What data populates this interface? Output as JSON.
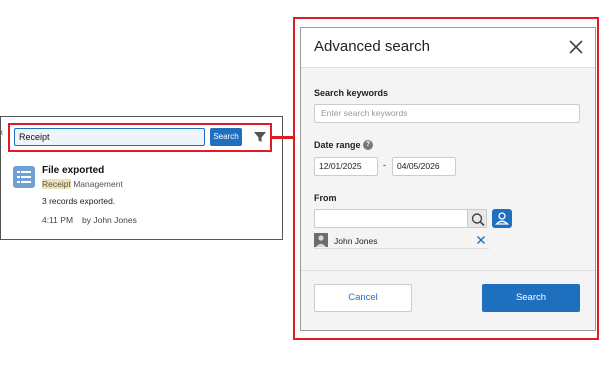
{
  "left": {
    "search_value": "Receipt",
    "search_button": "Search",
    "result": {
      "title": "File exported",
      "source_highlight": "Receipt",
      "source_rest": " Management",
      "detail": "3 records exported.",
      "time": "4:11 PM",
      "by": "by John Jones"
    }
  },
  "dialog": {
    "title": "Advanced search",
    "keywords_label": "Search keywords",
    "keywords_placeholder": "Enter search keywords",
    "date_label": "Date range",
    "help_glyph": "?",
    "date_from": "12/01/2025",
    "date_sep": "-",
    "date_to": "04/05/2026",
    "from_label": "From",
    "selected_user": "John Jones",
    "cancel_label": "Cancel",
    "search_label": "Search"
  },
  "colors": {
    "accent": "#1f6fbf",
    "highlight_outline": "#e01b24",
    "keyword_highlight": "#efe2b4"
  }
}
